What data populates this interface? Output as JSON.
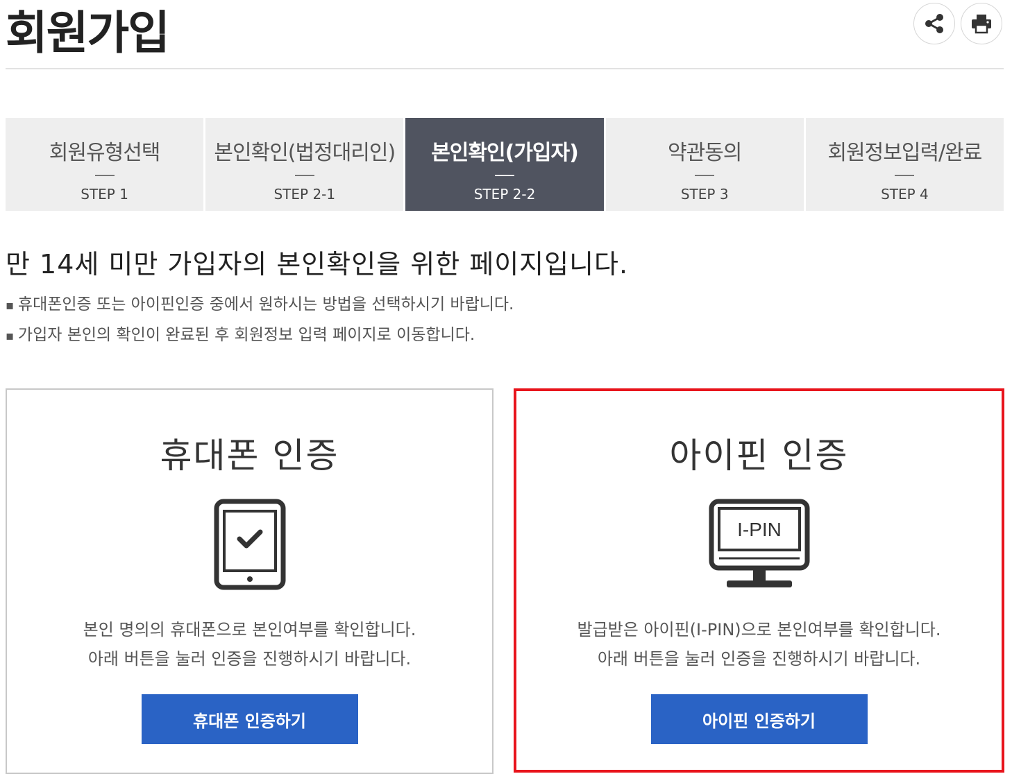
{
  "page": {
    "title": "회원가입"
  },
  "actions": {
    "share": "share-icon",
    "print": "print-icon"
  },
  "steps": [
    {
      "label": "회원유형선택",
      "num": "STEP 1",
      "active": false
    },
    {
      "label": "본인확인(법정대리인)",
      "num": "STEP 2-1",
      "active": false
    },
    {
      "label": "본인확인(가입자)",
      "num": "STEP 2-2",
      "active": true
    },
    {
      "label": "약관동의",
      "num": "STEP 3",
      "active": false
    },
    {
      "label": "회원정보입력/완료",
      "num": "STEP 4",
      "active": false
    }
  ],
  "intro": {
    "headline": "만 14세 미만 가입자의 본인확인을 위한 페이지입니다.",
    "notes": [
      "휴대폰인증 또는 아이핀인증 중에서 원하시는 방법을 선택하시기 바랍니다.",
      "가입자 본인의 확인이 완료된 후 회원정보 입력 페이지로 이동합니다."
    ]
  },
  "phone_card": {
    "title": "휴대폰 인증",
    "icon": "tablet-check-icon",
    "desc": [
      "본인 명의의 휴대폰으로 본인여부를 확인합니다.",
      "아래 버튼을 눌러 인증을 진행하시기 바랍니다."
    ],
    "button": "휴대폰 인증하기"
  },
  "ipin_card": {
    "title": "아이핀 인증",
    "icon": "monitor-ipin-icon",
    "icon_text": "I-PIN",
    "desc": [
      "발급받은 아이핀(I-PIN)으로 본인여부를 확인합니다.",
      "아래 버튼을 눌러 인증을 진행하시기 바랍니다."
    ],
    "button": "아이핀 인증하기",
    "highlight_color": "#e8141c"
  },
  "colors": {
    "active_step": "#505460",
    "button": "#2a63c5"
  }
}
